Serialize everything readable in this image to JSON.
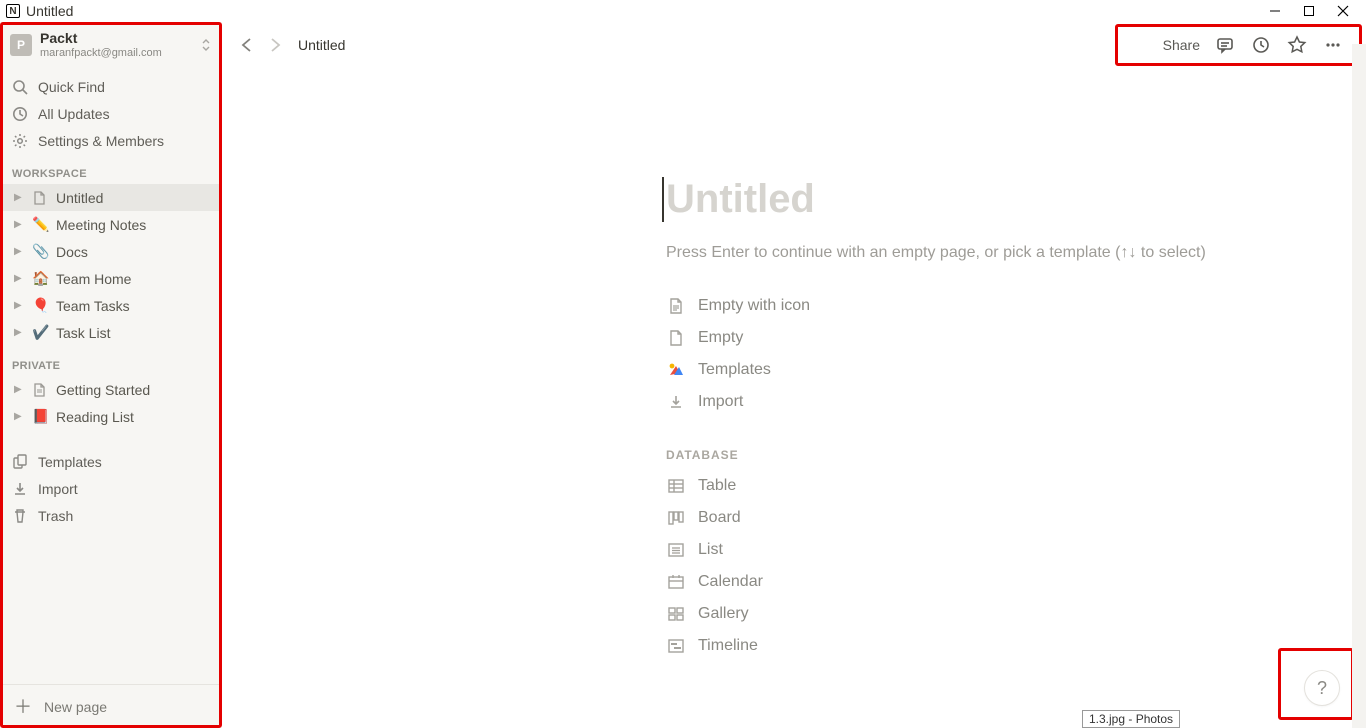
{
  "window": {
    "title": "Untitled"
  },
  "workspace": {
    "avatar_letter": "P",
    "name": "Packt",
    "email": "maranfpackt@gmail.com"
  },
  "sidebar": {
    "quick_find": "Quick Find",
    "all_updates": "All Updates",
    "settings_members": "Settings & Members",
    "workspace_label": "WORKSPACE",
    "private_label": "PRIVATE",
    "workspace_items": [
      {
        "emoji": "page",
        "label": "Untitled",
        "active": true
      },
      {
        "emoji": "✏️",
        "label": "Meeting Notes"
      },
      {
        "emoji": "📎",
        "label": "Docs"
      },
      {
        "emoji": "🏠",
        "label": "Team Home"
      },
      {
        "emoji": "🎈",
        "label": "Team Tasks"
      },
      {
        "emoji": "✔️",
        "label": "Task List"
      }
    ],
    "private_items": [
      {
        "emoji": "page",
        "label": "Getting Started"
      },
      {
        "emoji": "📕",
        "label": "Reading List"
      }
    ],
    "templates": "Templates",
    "import": "Import",
    "trash": "Trash",
    "new_page": "New page"
  },
  "topbar": {
    "breadcrumb": "Untitled",
    "share": "Share"
  },
  "page": {
    "title_placeholder": "Untitled",
    "hint": "Press Enter to continue with an empty page, or pick a template (↑↓ to select)",
    "options": {
      "empty_icon": "Empty with icon",
      "empty": "Empty",
      "templates": "Templates",
      "import": "Import"
    },
    "database_label": "DATABASE",
    "db": {
      "table": "Table",
      "board": "Board",
      "list": "List",
      "calendar": "Calendar",
      "gallery": "Gallery",
      "timeline": "Timeline"
    }
  },
  "help": "?",
  "taskbar_tooltip": "1.3.jpg - Photos"
}
